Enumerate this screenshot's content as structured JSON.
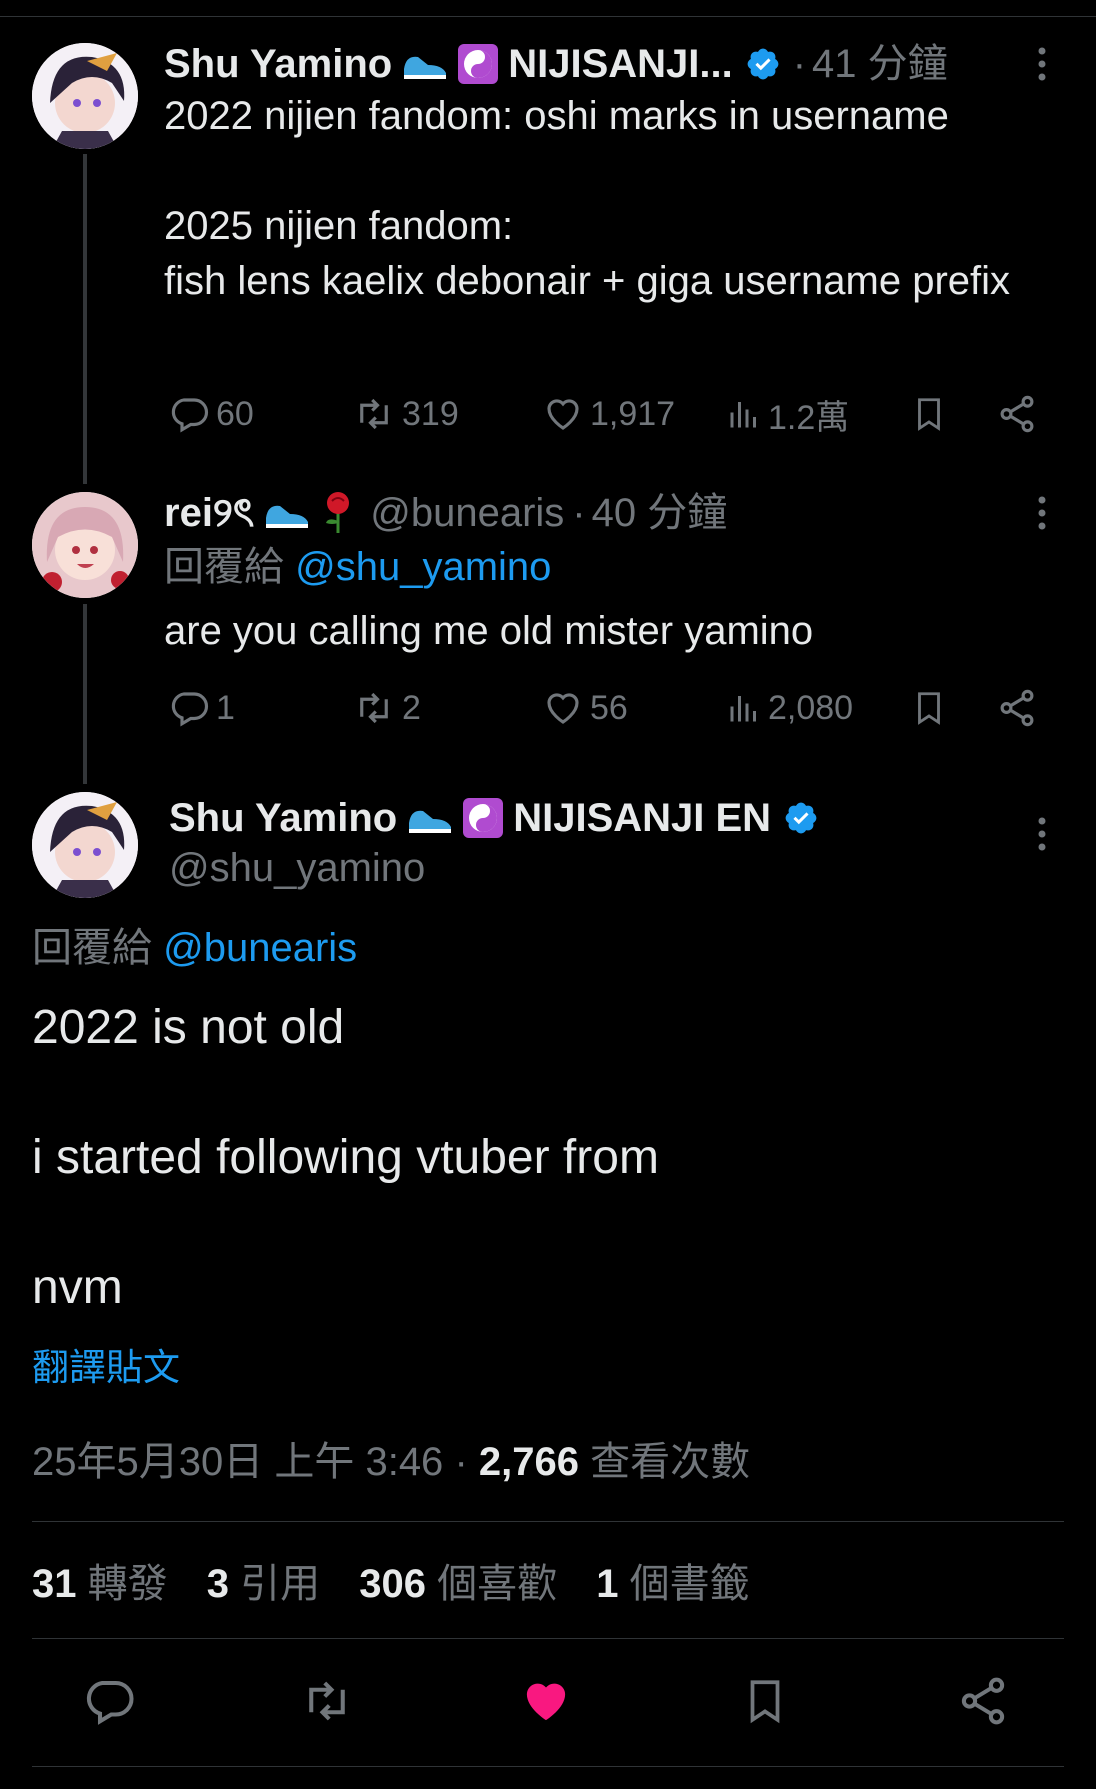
{
  "tweet1": {
    "name": "Shu Yamino",
    "name_suffix": "NIJISANJI...",
    "time": "41 分鐘",
    "text": "2022 nijien fandom: oshi marks in username\n\n2025 nijien fandom:\nfish lens kaelix debonair + giga username prefix",
    "replies": "60",
    "retweets": "319",
    "likes": "1,917",
    "views": "1.2萬"
  },
  "tweet2": {
    "name": "rei୨ৎ",
    "handle": "@bunearis",
    "time": "40 分鐘",
    "reply_label": "回覆給",
    "reply_mention": "@shu_yamino",
    "text": "are you calling me old mister yamino",
    "replies": "1",
    "retweets": "2",
    "likes": "56",
    "views": "2,080"
  },
  "main": {
    "name": "Shu Yamino",
    "name_suffix": "NIJISANJI EN",
    "handle": "@shu_yamino",
    "reply_label": "回覆給",
    "reply_mention": "@bunearis",
    "text": "2022 is not old\n\ni started following vtuber from\n\nnvm",
    "translate": "翻譯貼文",
    "timestamp": "25年5月30日 上午 3:46",
    "views_count": "2,766",
    "views_label": "查看次數",
    "stats": {
      "retweets": "31",
      "retweets_label": "轉發",
      "quotes": "3",
      "quotes_label": "引用",
      "likes": "306",
      "likes_label": "個喜歡",
      "bookmarks": "1",
      "bookmarks_label": "個書籤"
    }
  },
  "icons": {
    "reply": "reply-icon",
    "retweet": "retweet-icon",
    "like": "heart-icon",
    "views": "views-icon",
    "bookmark": "bookmark-icon",
    "share": "share-icon"
  },
  "colors": {
    "accent": "#1d9bf0",
    "like_active": "#f91880",
    "muted": "#71767b",
    "text": "#e7e9ea"
  }
}
